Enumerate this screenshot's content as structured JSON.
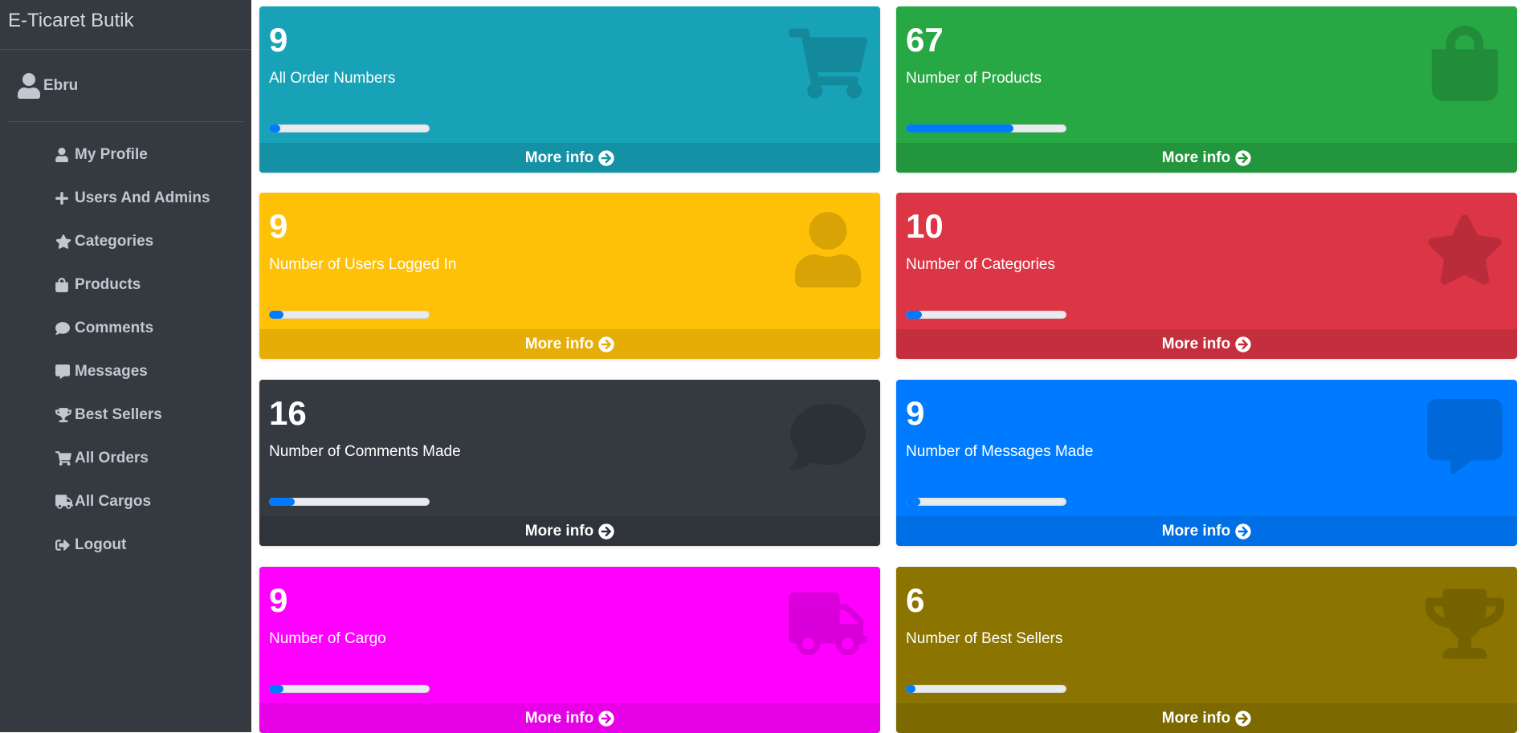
{
  "app": {
    "brand": "E-Ticaret Butik"
  },
  "user": {
    "name": "Ebru"
  },
  "sidebar": {
    "items": [
      {
        "label": "My Profile",
        "icon": "user-icon"
      },
      {
        "label": "Users And Admins",
        "icon": "plus-icon"
      },
      {
        "label": "Categories",
        "icon": "star-icon"
      },
      {
        "label": "Products",
        "icon": "shopping-bag-icon"
      },
      {
        "label": "Comments",
        "icon": "comment-icon"
      },
      {
        "label": "Messages",
        "icon": "message-icon"
      },
      {
        "label": "Best Sellers",
        "icon": "trophy-icon"
      },
      {
        "label": "All Orders",
        "icon": "cart-icon"
      },
      {
        "label": "All Cargos",
        "icon": "truck-icon"
      },
      {
        "label": "Logout",
        "icon": "logout-icon"
      }
    ]
  },
  "cards": [
    {
      "value": "9",
      "label": "All Order Numbers",
      "more": "More info",
      "color": "#17a2b8",
      "icon": "cart-icon",
      "progress": 0.07
    },
    {
      "value": "67",
      "label": "Number of Products",
      "more": "More info",
      "color": "#28a745",
      "icon": "shopping-bag-icon",
      "progress": 0.67
    },
    {
      "value": "9",
      "label": "Number of Users Logged In",
      "more": "More info",
      "color": "#ffc107",
      "icon": "user-icon",
      "progress": 0.09
    },
    {
      "value": "10",
      "label": "Number of Categories",
      "more": "More info",
      "color": "#dc3545",
      "icon": "star-icon",
      "progress": 0.1
    },
    {
      "value": "16",
      "label": "Number of Comments Made",
      "more": "More info",
      "color": "#343a40",
      "icon": "comment-icon",
      "progress": 0.16
    },
    {
      "value": "9",
      "label": "Number of Messages Made",
      "more": "More info",
      "color": "#007bff",
      "icon": "message-icon",
      "progress": 0.09
    },
    {
      "value": "9",
      "label": "Number of Cargo",
      "more": "More info",
      "color": "#ff00ff",
      "icon": "truck-icon",
      "progress": 0.09
    },
    {
      "value": "6",
      "label": "Number of Best Sellers",
      "more": "More info",
      "color": "#8b7500",
      "icon": "trophy-icon",
      "progress": 0.06
    }
  ]
}
